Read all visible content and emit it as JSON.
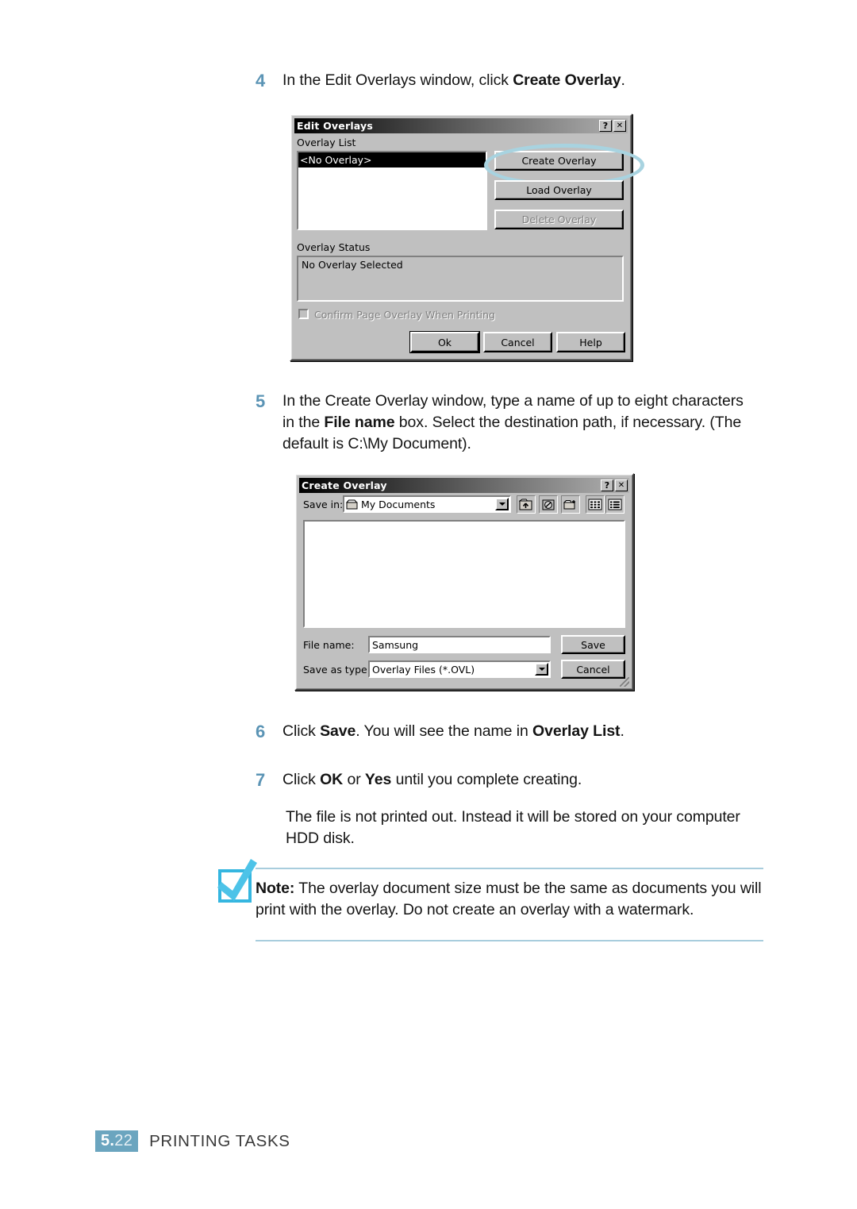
{
  "page": {
    "folio_major": "5.",
    "folio_minor": "22",
    "footer_title": "PRINTING TASKS"
  },
  "steps": [
    {
      "num": "4",
      "text_parts": [
        {
          "t": "In the Edit Overlays window, click ",
          "b": false
        },
        {
          "t": "Create Overlay",
          "b": true
        },
        {
          "t": ".",
          "b": false
        }
      ]
    },
    {
      "num": "5",
      "text_parts": [
        {
          "t": "In the Create Overlay window, type a name of up to eight characters in the ",
          "b": false
        },
        {
          "t": "File name",
          "b": true
        },
        {
          "t": " box. Select the destination path, if necessary. (The default is C:\\My Document).",
          "b": false
        }
      ]
    },
    {
      "num": "6",
      "text_parts": [
        {
          "t": "Click ",
          "b": false
        },
        {
          "t": "Save",
          "b": true
        },
        {
          "t": ". You will see the name in ",
          "b": false
        },
        {
          "t": "Overlay List",
          "b": true
        },
        {
          "t": ".",
          "b": false
        }
      ]
    },
    {
      "num": "7",
      "text_parts": [
        {
          "t": "Click ",
          "b": false
        },
        {
          "t": "OK",
          "b": true
        },
        {
          "t": " or ",
          "b": false
        },
        {
          "t": "Yes",
          "b": true
        },
        {
          "t": " until you complete creating.",
          "b": false
        }
      ]
    }
  ],
  "paragraph_after_step7": "The file is not printed out. Instead it will be stored on your computer HDD disk.",
  "note": {
    "label": "Note:",
    "text": " The overlay document size must be the same as documents you will print with the overlay. Do not create an overlay with a watermark."
  },
  "edit_overlays_dialog": {
    "title": "Edit Overlays",
    "help_button": "?",
    "close_button": "✕",
    "overlay_list_label": "Overlay List",
    "overlay_list_items": [
      "<No Overlay>"
    ],
    "buttons": {
      "create_overlay": "Create Overlay",
      "load_overlay": "Load Overlay",
      "delete_overlay": "Delete Overlay"
    },
    "overlay_status_label": "Overlay Status",
    "overlay_status_value": "No Overlay Selected",
    "confirm_checkbox_label": "Confirm Page Overlay When Printing",
    "confirm_checkbox_checked": false,
    "footer_buttons": {
      "ok": "Ok",
      "cancel": "Cancel",
      "help": "Help"
    },
    "highlight_color": "#a8d3e0"
  },
  "create_overlay_dialog": {
    "title": "Create Overlay",
    "help_button": "?",
    "close_button": "✕",
    "save_in_label": "Save in:",
    "save_in_value": "My Documents",
    "toolbar_icons": [
      "up-one-level-icon",
      "create-new-folder-icon",
      "new-folder-icon",
      "list-view-icon",
      "details-view-icon"
    ],
    "file_list_items": [],
    "file_name_label": "File name:",
    "file_name_value": "Samsung",
    "save_as_type_label": "Save as type:",
    "save_as_type_value": "Overlay Files (*.OVL)",
    "buttons": {
      "save": "Save",
      "cancel": "Cancel"
    }
  }
}
